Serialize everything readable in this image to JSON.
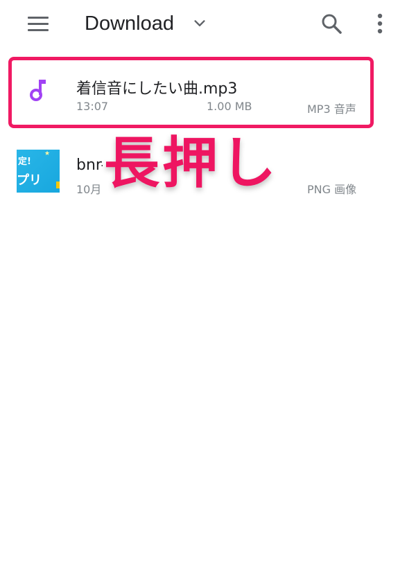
{
  "app_bar": {
    "title": "Download",
    "icons": {
      "menu": "menu-icon",
      "dropdown": "chevron-down-icon",
      "search": "search-icon",
      "more": "more-vert-icon"
    }
  },
  "files": [
    {
      "name": "着信音にしたい曲.mp3",
      "time": "13:07",
      "size": "1.00 MB",
      "type": "MP3 音声",
      "icon": "music-note-icon",
      "highlighted": true
    },
    {
      "name": "bnr-",
      "date": "10月",
      "type": "PNG 画像",
      "icon": "image-thumbnail",
      "thumbnail_text": [
        "定!",
        "プリ"
      ]
    }
  ],
  "overlay": {
    "label": "長押し",
    "color": "#ee1561"
  },
  "colors": {
    "highlight_border": "#f01a63",
    "music_icon": "#a142f4",
    "thumbnail_bg": "#29b6e8"
  }
}
